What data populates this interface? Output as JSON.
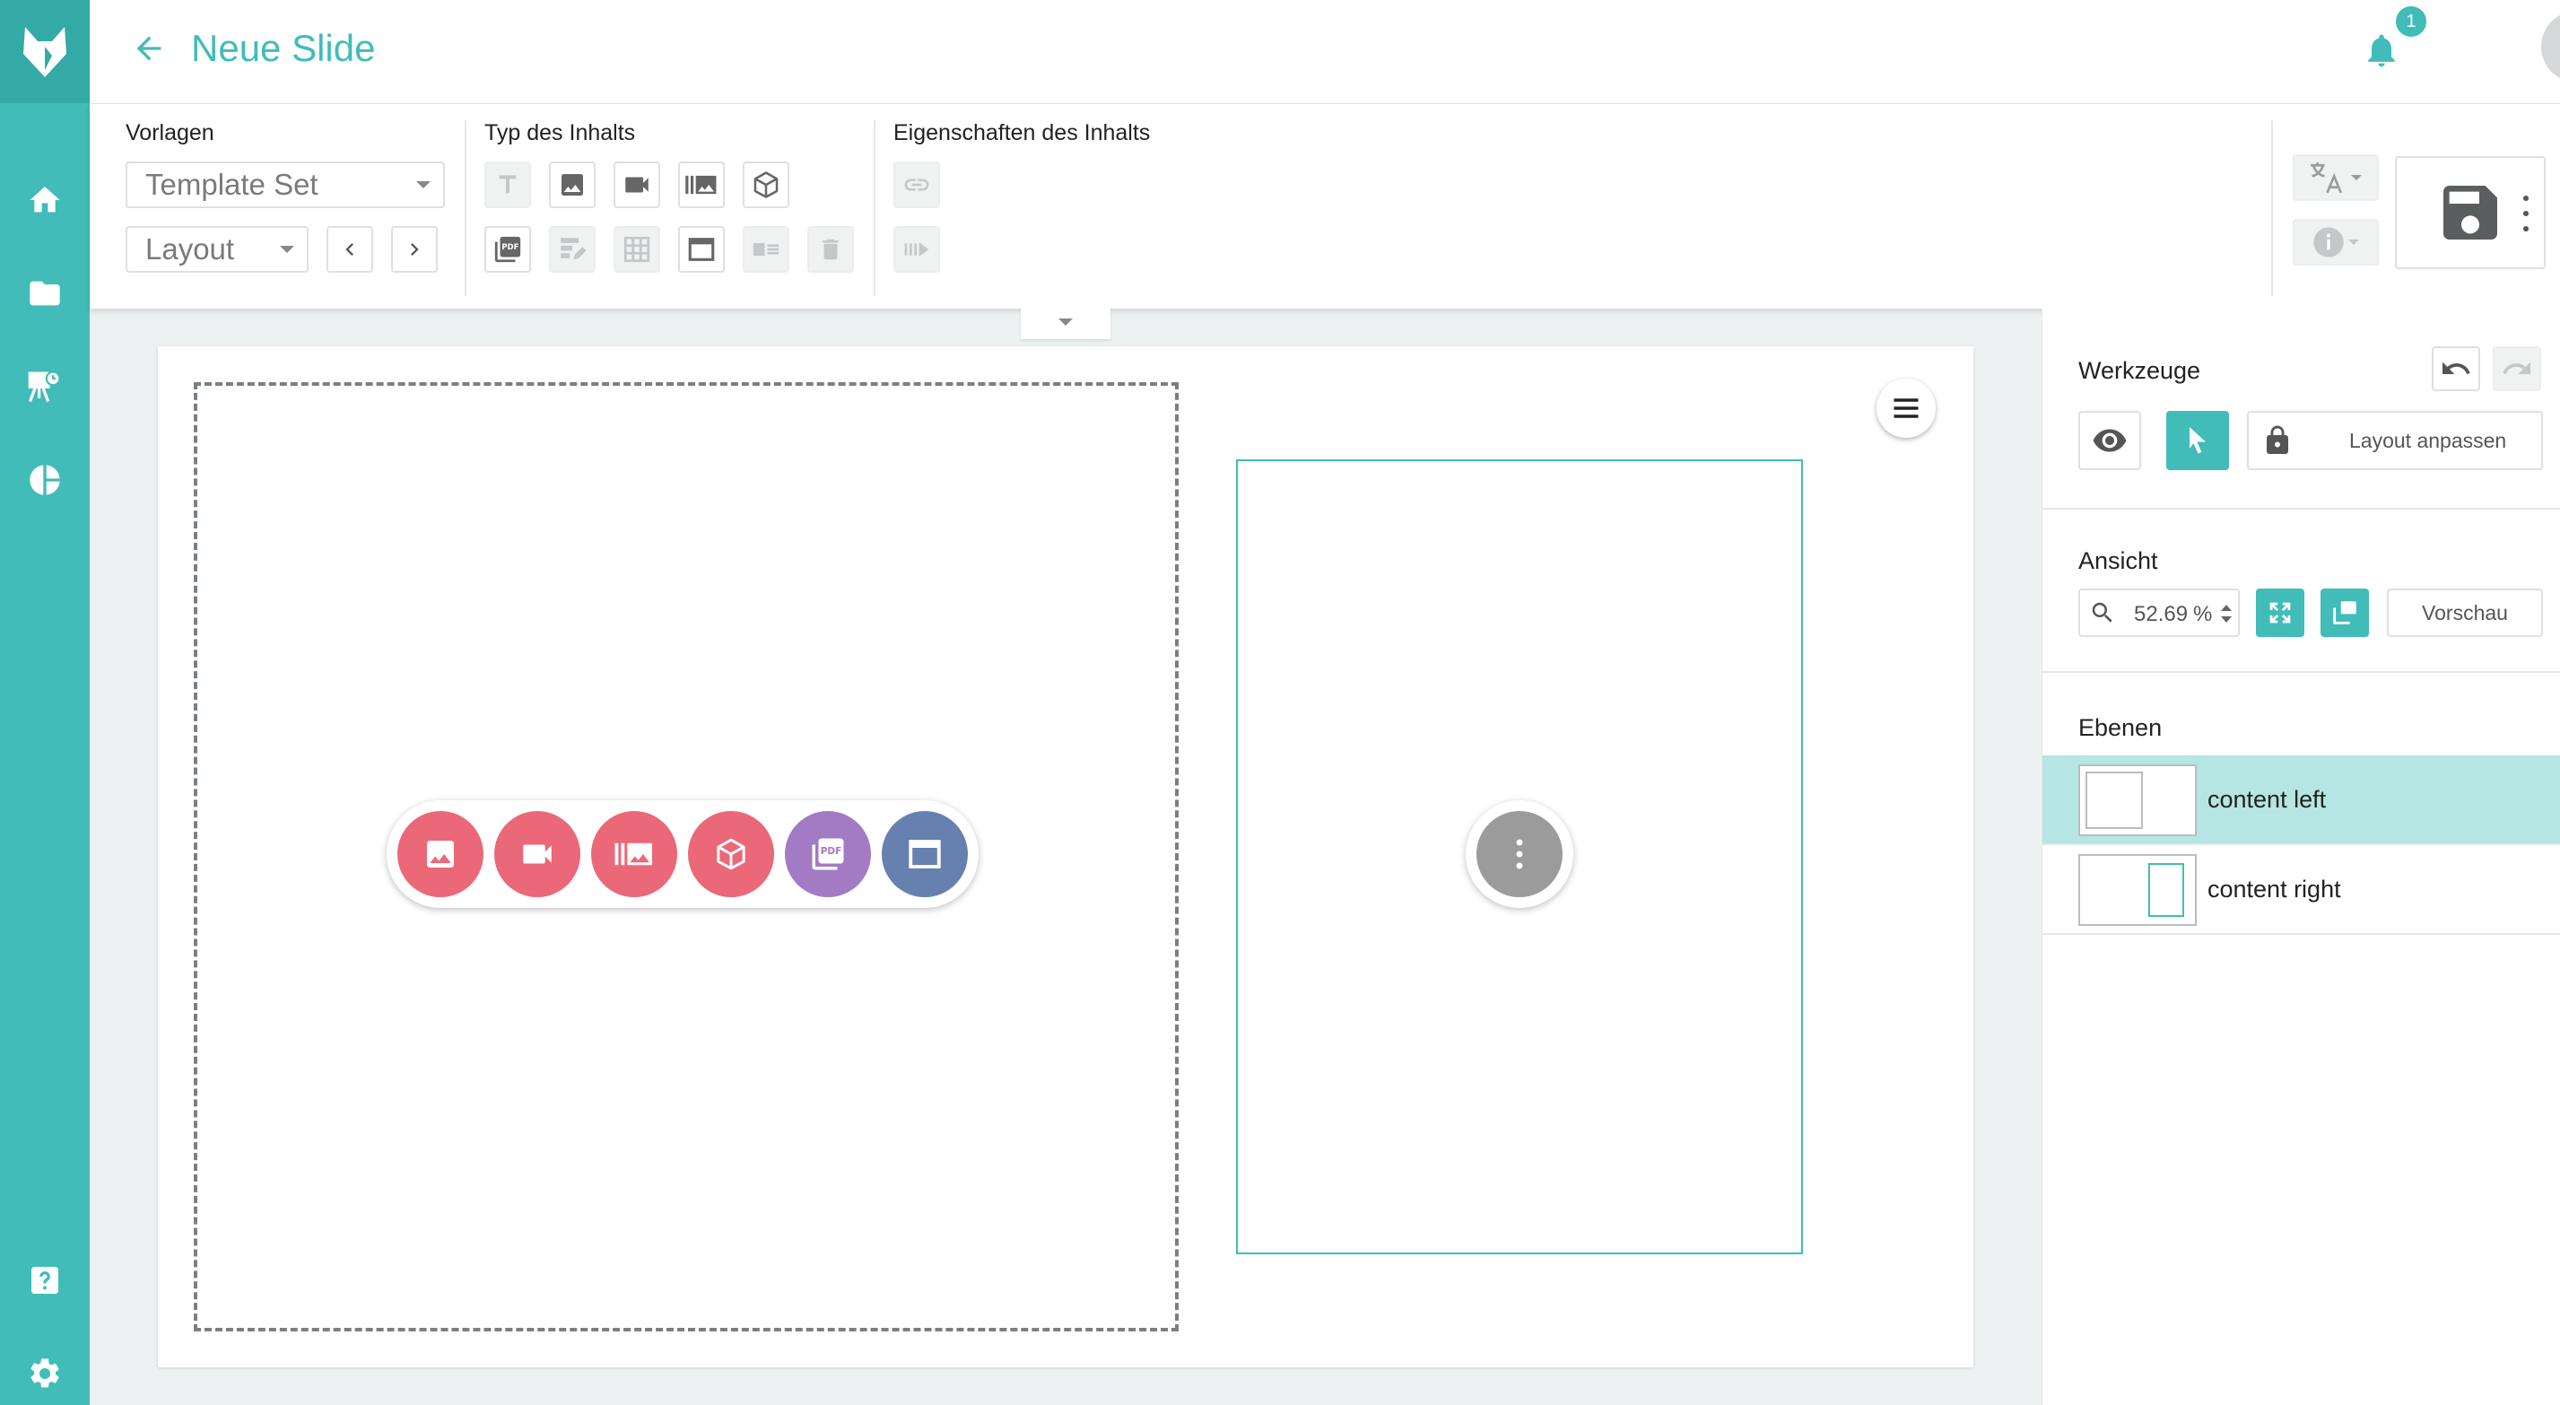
{
  "colors": {
    "accent": "#41bcb8",
    "accent_dark": "#34aaa6",
    "fab_red": "#ea6878",
    "fab_purple": "#a27bc4",
    "fab_blue": "#6681b0",
    "fab_gray": "#9b9b9b"
  },
  "nav": {
    "logo_icon": "fox-logo-icon",
    "items": [
      {
        "icon": "home-icon"
      },
      {
        "icon": "folder-icon"
      },
      {
        "icon": "presentation-icon"
      },
      {
        "icon": "pie-chart-icon"
      },
      {
        "icon": "help-icon"
      },
      {
        "icon": "settings-icon"
      }
    ]
  },
  "header": {
    "title": "Neue Slide",
    "notification_count": "1"
  },
  "toolbar": {
    "vorlagen_label": "Vorlagen",
    "template_set": "Template Set",
    "layout": "Layout",
    "typ_label": "Typ des Inhalts",
    "eigenschaften_label": "Eigenschaften des Inhalts"
  },
  "panel": {
    "werkzeuge_label": "Werkzeuge",
    "layout_anpassen": "Layout anpassen",
    "ansicht_label": "Ansicht",
    "zoom": "52.69",
    "zoom_unit": "%",
    "vorschau": "Vorschau",
    "ebenen_label": "Ebenen",
    "layers": [
      {
        "name": "content left",
        "selected": true
      },
      {
        "name": "content right",
        "selected": false
      }
    ]
  }
}
